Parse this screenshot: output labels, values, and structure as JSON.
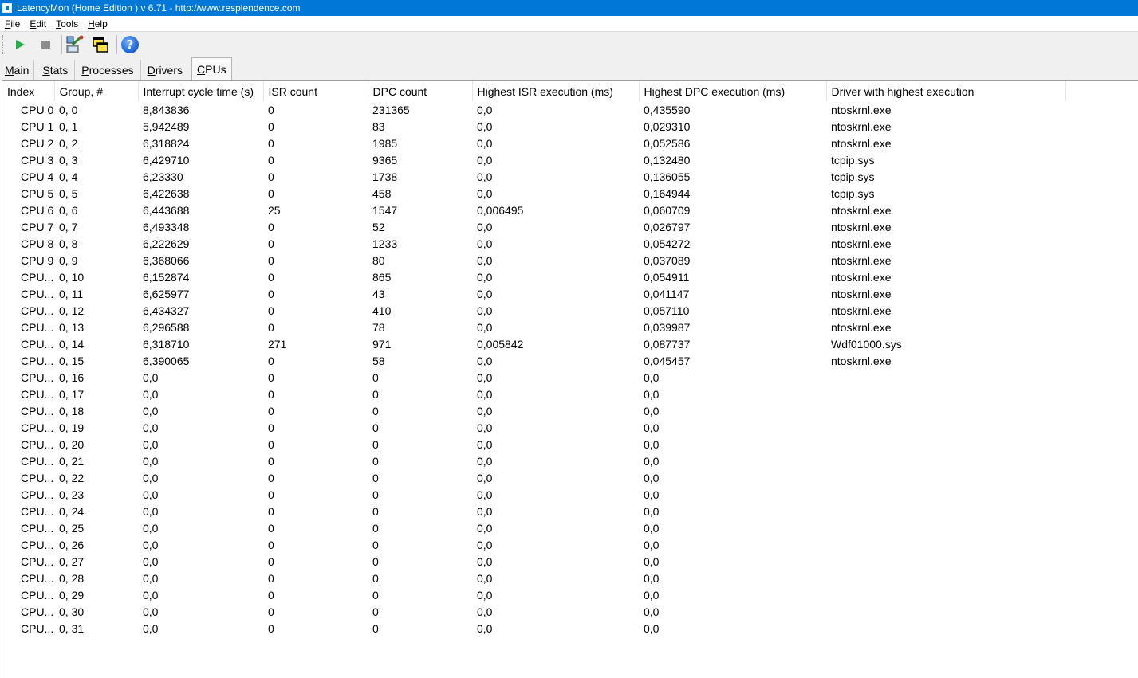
{
  "window": {
    "title": "LatencyMon  (Home Edition )  v 6.71 - http://www.resplendence.com"
  },
  "menu": [
    {
      "ul": "F",
      "rest": "ile"
    },
    {
      "ul": "E",
      "rest": "dit"
    },
    {
      "ul": "T",
      "rest": "ools"
    },
    {
      "ul": "H",
      "rest": "elp"
    }
  ],
  "toolbar": {
    "icons": [
      "play-icon",
      "stop-icon",
      "driver-analysis-icon",
      "windows-icon",
      "help-icon"
    ],
    "colors": {
      "play": "#22b14c",
      "stop": "#8c8c8c",
      "help": "#1a5fd0"
    }
  },
  "tabs": [
    {
      "ul": "M",
      "rest": "ain",
      "active": false
    },
    {
      "ul": "S",
      "rest": "tats",
      "active": false
    },
    {
      "ul": "P",
      "rest": "rocesses",
      "active": false
    },
    {
      "ul": "D",
      "rest": "rivers",
      "active": false
    },
    {
      "ul": "C",
      "rest": "PUs",
      "active": true
    }
  ],
  "table": {
    "columns": [
      "Index",
      "Group, #",
      "Interrupt cycle time (s)",
      "ISR count",
      "DPC count",
      "Highest ISR execution (ms)",
      "Highest DPC execution (ms)",
      "Driver with highest execution"
    ],
    "rows": [
      [
        "CPU 0",
        "0, 0",
        "8,843836",
        "0",
        "231365",
        "0,0",
        "0,435590",
        "ntoskrnl.exe"
      ],
      [
        "CPU 1",
        "0, 1",
        "5,942489",
        "0",
        "83",
        "0,0",
        "0,029310",
        "ntoskrnl.exe"
      ],
      [
        "CPU 2",
        "0, 2",
        "6,318824",
        "0",
        "1985",
        "0,0",
        "0,052586",
        "ntoskrnl.exe"
      ],
      [
        "CPU 3",
        "0, 3",
        "6,429710",
        "0",
        "9365",
        "0,0",
        "0,132480",
        "tcpip.sys"
      ],
      [
        "CPU 4",
        "0, 4",
        "6,23330",
        "0",
        "1738",
        "0,0",
        "0,136055",
        "tcpip.sys"
      ],
      [
        "CPU 5",
        "0, 5",
        "6,422638",
        "0",
        "458",
        "0,0",
        "0,164944",
        "tcpip.sys"
      ],
      [
        "CPU 6",
        "0, 6",
        "6,443688",
        "25",
        "1547",
        "0,006495",
        "0,060709",
        "ntoskrnl.exe"
      ],
      [
        "CPU 7",
        "0, 7",
        "6,493348",
        "0",
        "52",
        "0,0",
        "0,026797",
        "ntoskrnl.exe"
      ],
      [
        "CPU 8",
        "0, 8",
        "6,222629",
        "0",
        "1233",
        "0,0",
        "0,054272",
        "ntoskrnl.exe"
      ],
      [
        "CPU 9",
        "0, 9",
        "6,368066",
        "0",
        "80",
        "0,0",
        "0,037089",
        "ntoskrnl.exe"
      ],
      [
        "CPU...",
        "0, 10",
        "6,152874",
        "0",
        "865",
        "0,0",
        "0,054911",
        "ntoskrnl.exe"
      ],
      [
        "CPU...",
        "0, 11",
        "6,625977",
        "0",
        "43",
        "0,0",
        "0,041147",
        "ntoskrnl.exe"
      ],
      [
        "CPU...",
        "0, 12",
        "6,434327",
        "0",
        "410",
        "0,0",
        "0,057110",
        "ntoskrnl.exe"
      ],
      [
        "CPU...",
        "0, 13",
        "6,296588",
        "0",
        "78",
        "0,0",
        "0,039987",
        "ntoskrnl.exe"
      ],
      [
        "CPU...",
        "0, 14",
        "6,318710",
        "271",
        "971",
        "0,005842",
        "0,087737",
        "Wdf01000.sys"
      ],
      [
        "CPU...",
        "0, 15",
        "6,390065",
        "0",
        "58",
        "0,0",
        "0,045457",
        "ntoskrnl.exe"
      ],
      [
        "CPU...",
        "0, 16",
        "0,0",
        "0",
        "0",
        "0,0",
        "0,0",
        ""
      ],
      [
        "CPU...",
        "0, 17",
        "0,0",
        "0",
        "0",
        "0,0",
        "0,0",
        ""
      ],
      [
        "CPU...",
        "0, 18",
        "0,0",
        "0",
        "0",
        "0,0",
        "0,0",
        ""
      ],
      [
        "CPU...",
        "0, 19",
        "0,0",
        "0",
        "0",
        "0,0",
        "0,0",
        ""
      ],
      [
        "CPU...",
        "0, 20",
        "0,0",
        "0",
        "0",
        "0,0",
        "0,0",
        ""
      ],
      [
        "CPU...",
        "0, 21",
        "0,0",
        "0",
        "0",
        "0,0",
        "0,0",
        ""
      ],
      [
        "CPU...",
        "0, 22",
        "0,0",
        "0",
        "0",
        "0,0",
        "0,0",
        ""
      ],
      [
        "CPU...",
        "0, 23",
        "0,0",
        "0",
        "0",
        "0,0",
        "0,0",
        ""
      ],
      [
        "CPU...",
        "0, 24",
        "0,0",
        "0",
        "0",
        "0,0",
        "0,0",
        ""
      ],
      [
        "CPU...",
        "0, 25",
        "0,0",
        "0",
        "0",
        "0,0",
        "0,0",
        ""
      ],
      [
        "CPU...",
        "0, 26",
        "0,0",
        "0",
        "0",
        "0,0",
        "0,0",
        ""
      ],
      [
        "CPU...",
        "0, 27",
        "0,0",
        "0",
        "0",
        "0,0",
        "0,0",
        ""
      ],
      [
        "CPU...",
        "0, 28",
        "0,0",
        "0",
        "0",
        "0,0",
        "0,0",
        ""
      ],
      [
        "CPU...",
        "0, 29",
        "0,0",
        "0",
        "0",
        "0,0",
        "0,0",
        ""
      ],
      [
        "CPU...",
        "0, 30",
        "0,0",
        "0",
        "0",
        "0,0",
        "0,0",
        ""
      ],
      [
        "CPU...",
        "0, 31",
        "0,0",
        "0",
        "0",
        "0,0",
        "0,0",
        ""
      ]
    ]
  }
}
